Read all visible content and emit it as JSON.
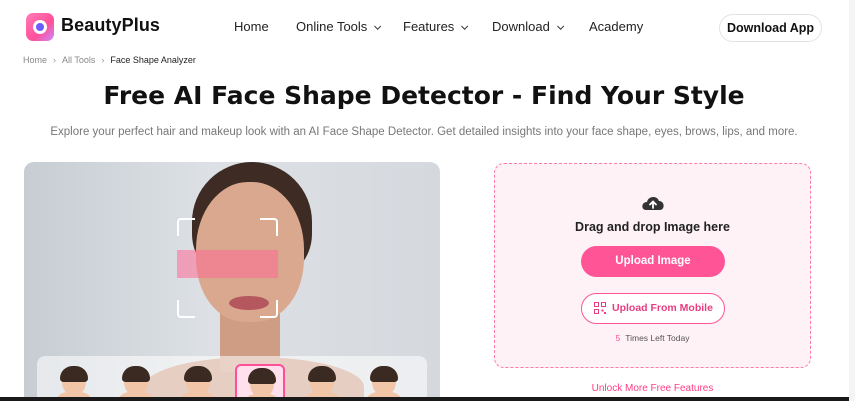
{
  "header": {
    "brand": "BeautyPlus",
    "nav": [
      {
        "label": "Home",
        "dropdown": false
      },
      {
        "label": "Online Tools",
        "dropdown": true
      },
      {
        "label": "Features",
        "dropdown": true
      },
      {
        "label": "Download",
        "dropdown": true
      },
      {
        "label": "Academy",
        "dropdown": false
      }
    ],
    "download_app": "Download App"
  },
  "breadcrumb": [
    "Home",
    "All Tools",
    "Face Shape Analyzer"
  ],
  "title": "Free AI Face Shape Detector - Find Your Style",
  "subtitle": "Explore your perfect hair and makeup look with an AI Face Shape Detector. Get detailed insights into your face shape, eyes, brows, lips, and more.",
  "upload": {
    "drag_text": "Drag and drop Image here",
    "upload_button": "Upload Image",
    "mobile_button": "Upload From Mobile",
    "times_count": "5",
    "times_text": "Times Left Today",
    "unlock": "Unlock More Free Features"
  },
  "thumbnails": {
    "count": 6,
    "active_index": 3
  },
  "colors": {
    "accent": "#ff5597",
    "accent_light": "#fff2f6"
  }
}
